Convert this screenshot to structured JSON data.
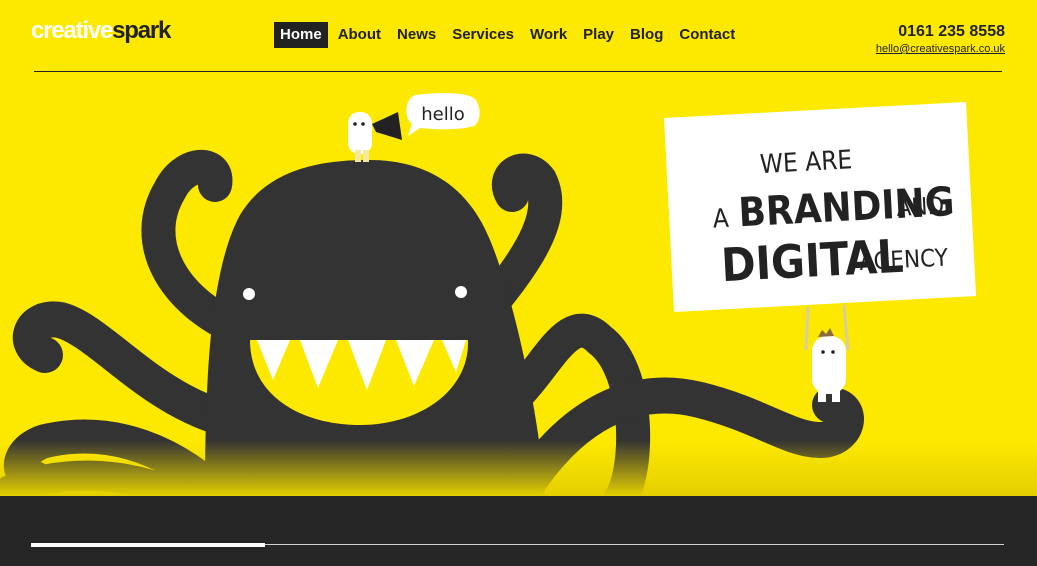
{
  "logo": {
    "part1": "creative",
    "part2": "spark"
  },
  "nav": {
    "items": [
      {
        "label": "Home",
        "active": true
      },
      {
        "label": "About"
      },
      {
        "label": "News"
      },
      {
        "label": "Services"
      },
      {
        "label": "Work"
      },
      {
        "label": "Play"
      },
      {
        "label": "Blog"
      },
      {
        "label": "Contact"
      }
    ]
  },
  "contact": {
    "phone": "0161 235 8558",
    "email": "hello@creativespark.co.uk"
  },
  "hero": {
    "speech": "hello",
    "sign": {
      "line1": "WE ARE",
      "line2a": "A",
      "line2b": "BRANDING",
      "line2c": "AND",
      "line3a": "DIGITAL",
      "line3b": "AGENCY"
    }
  },
  "slider": {
    "progress": 0.24
  },
  "colors": {
    "brand_yellow": "#fde900",
    "dark": "#222222",
    "footer": "#262626",
    "white": "#ffffff"
  }
}
